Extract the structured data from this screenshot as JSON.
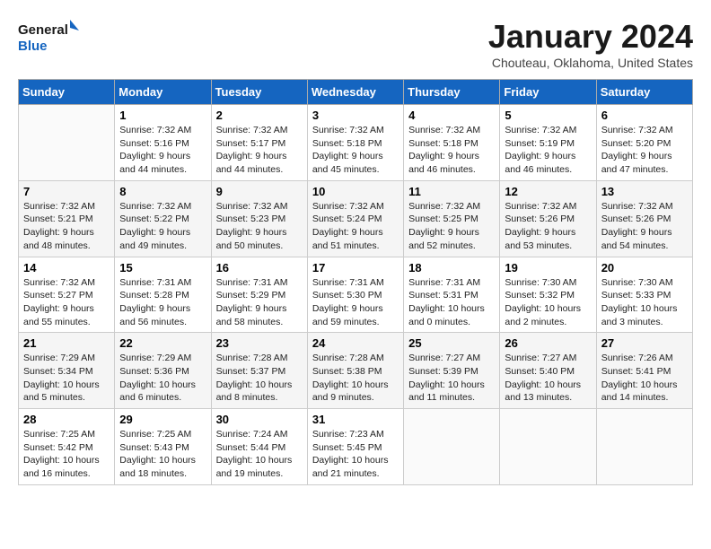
{
  "logo": {
    "line1": "General",
    "line2": "Blue"
  },
  "title": "January 2024",
  "subtitle": "Chouteau, Oklahoma, United States",
  "days_header": [
    "Sunday",
    "Monday",
    "Tuesday",
    "Wednesday",
    "Thursday",
    "Friday",
    "Saturday"
  ],
  "weeks": [
    [
      {
        "day": "",
        "sunrise": "",
        "sunset": "",
        "daylight": ""
      },
      {
        "day": "1",
        "sunrise": "Sunrise: 7:32 AM",
        "sunset": "Sunset: 5:16 PM",
        "daylight": "Daylight: 9 hours and 44 minutes."
      },
      {
        "day": "2",
        "sunrise": "Sunrise: 7:32 AM",
        "sunset": "Sunset: 5:17 PM",
        "daylight": "Daylight: 9 hours and 44 minutes."
      },
      {
        "day": "3",
        "sunrise": "Sunrise: 7:32 AM",
        "sunset": "Sunset: 5:18 PM",
        "daylight": "Daylight: 9 hours and 45 minutes."
      },
      {
        "day": "4",
        "sunrise": "Sunrise: 7:32 AM",
        "sunset": "Sunset: 5:18 PM",
        "daylight": "Daylight: 9 hours and 46 minutes."
      },
      {
        "day": "5",
        "sunrise": "Sunrise: 7:32 AM",
        "sunset": "Sunset: 5:19 PM",
        "daylight": "Daylight: 9 hours and 46 minutes."
      },
      {
        "day": "6",
        "sunrise": "Sunrise: 7:32 AM",
        "sunset": "Sunset: 5:20 PM",
        "daylight": "Daylight: 9 hours and 47 minutes."
      }
    ],
    [
      {
        "day": "7",
        "sunrise": "Sunrise: 7:32 AM",
        "sunset": "Sunset: 5:21 PM",
        "daylight": "Daylight: 9 hours and 48 minutes."
      },
      {
        "day": "8",
        "sunrise": "Sunrise: 7:32 AM",
        "sunset": "Sunset: 5:22 PM",
        "daylight": "Daylight: 9 hours and 49 minutes."
      },
      {
        "day": "9",
        "sunrise": "Sunrise: 7:32 AM",
        "sunset": "Sunset: 5:23 PM",
        "daylight": "Daylight: 9 hours and 50 minutes."
      },
      {
        "day": "10",
        "sunrise": "Sunrise: 7:32 AM",
        "sunset": "Sunset: 5:24 PM",
        "daylight": "Daylight: 9 hours and 51 minutes."
      },
      {
        "day": "11",
        "sunrise": "Sunrise: 7:32 AM",
        "sunset": "Sunset: 5:25 PM",
        "daylight": "Daylight: 9 hours and 52 minutes."
      },
      {
        "day": "12",
        "sunrise": "Sunrise: 7:32 AM",
        "sunset": "Sunset: 5:26 PM",
        "daylight": "Daylight: 9 hours and 53 minutes."
      },
      {
        "day": "13",
        "sunrise": "Sunrise: 7:32 AM",
        "sunset": "Sunset: 5:26 PM",
        "daylight": "Daylight: 9 hours and 54 minutes."
      }
    ],
    [
      {
        "day": "14",
        "sunrise": "Sunrise: 7:32 AM",
        "sunset": "Sunset: 5:27 PM",
        "daylight": "Daylight: 9 hours and 55 minutes."
      },
      {
        "day": "15",
        "sunrise": "Sunrise: 7:31 AM",
        "sunset": "Sunset: 5:28 PM",
        "daylight": "Daylight: 9 hours and 56 minutes."
      },
      {
        "day": "16",
        "sunrise": "Sunrise: 7:31 AM",
        "sunset": "Sunset: 5:29 PM",
        "daylight": "Daylight: 9 hours and 58 minutes."
      },
      {
        "day": "17",
        "sunrise": "Sunrise: 7:31 AM",
        "sunset": "Sunset: 5:30 PM",
        "daylight": "Daylight: 9 hours and 59 minutes."
      },
      {
        "day": "18",
        "sunrise": "Sunrise: 7:31 AM",
        "sunset": "Sunset: 5:31 PM",
        "daylight": "Daylight: 10 hours and 0 minutes."
      },
      {
        "day": "19",
        "sunrise": "Sunrise: 7:30 AM",
        "sunset": "Sunset: 5:32 PM",
        "daylight": "Daylight: 10 hours and 2 minutes."
      },
      {
        "day": "20",
        "sunrise": "Sunrise: 7:30 AM",
        "sunset": "Sunset: 5:33 PM",
        "daylight": "Daylight: 10 hours and 3 minutes."
      }
    ],
    [
      {
        "day": "21",
        "sunrise": "Sunrise: 7:29 AM",
        "sunset": "Sunset: 5:34 PM",
        "daylight": "Daylight: 10 hours and 5 minutes."
      },
      {
        "day": "22",
        "sunrise": "Sunrise: 7:29 AM",
        "sunset": "Sunset: 5:36 PM",
        "daylight": "Daylight: 10 hours and 6 minutes."
      },
      {
        "day": "23",
        "sunrise": "Sunrise: 7:28 AM",
        "sunset": "Sunset: 5:37 PM",
        "daylight": "Daylight: 10 hours and 8 minutes."
      },
      {
        "day": "24",
        "sunrise": "Sunrise: 7:28 AM",
        "sunset": "Sunset: 5:38 PM",
        "daylight": "Daylight: 10 hours and 9 minutes."
      },
      {
        "day": "25",
        "sunrise": "Sunrise: 7:27 AM",
        "sunset": "Sunset: 5:39 PM",
        "daylight": "Daylight: 10 hours and 11 minutes."
      },
      {
        "day": "26",
        "sunrise": "Sunrise: 7:27 AM",
        "sunset": "Sunset: 5:40 PM",
        "daylight": "Daylight: 10 hours and 13 minutes."
      },
      {
        "day": "27",
        "sunrise": "Sunrise: 7:26 AM",
        "sunset": "Sunset: 5:41 PM",
        "daylight": "Daylight: 10 hours and 14 minutes."
      }
    ],
    [
      {
        "day": "28",
        "sunrise": "Sunrise: 7:25 AM",
        "sunset": "Sunset: 5:42 PM",
        "daylight": "Daylight: 10 hours and 16 minutes."
      },
      {
        "day": "29",
        "sunrise": "Sunrise: 7:25 AM",
        "sunset": "Sunset: 5:43 PM",
        "daylight": "Daylight: 10 hours and 18 minutes."
      },
      {
        "day": "30",
        "sunrise": "Sunrise: 7:24 AM",
        "sunset": "Sunset: 5:44 PM",
        "daylight": "Daylight: 10 hours and 19 minutes."
      },
      {
        "day": "31",
        "sunrise": "Sunrise: 7:23 AM",
        "sunset": "Sunset: 5:45 PM",
        "daylight": "Daylight: 10 hours and 21 minutes."
      },
      {
        "day": "",
        "sunrise": "",
        "sunset": "",
        "daylight": ""
      },
      {
        "day": "",
        "sunrise": "",
        "sunset": "",
        "daylight": ""
      },
      {
        "day": "",
        "sunrise": "",
        "sunset": "",
        "daylight": ""
      }
    ]
  ]
}
